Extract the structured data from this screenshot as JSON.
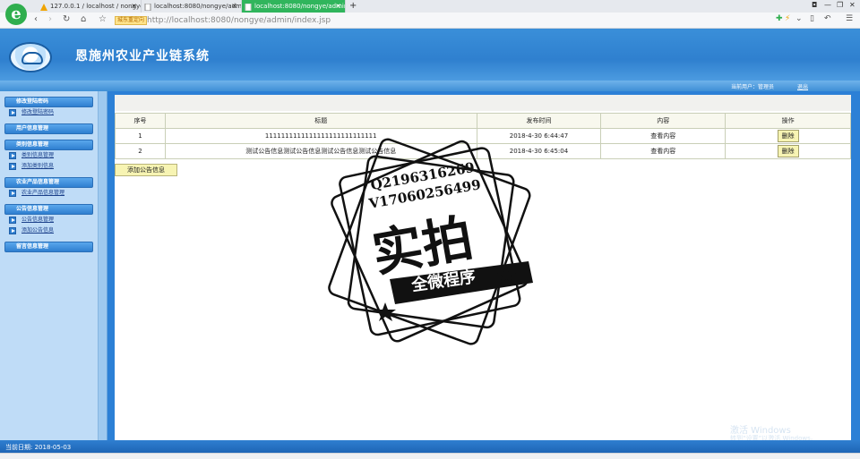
{
  "browser": {
    "tabs": [
      {
        "label": "127.0.0.1 / localhost / nongye",
        "active": false
      },
      {
        "label": "localhost:8080/nongye/admin",
        "active": false
      },
      {
        "label": "localhost:8080/nongye/admin",
        "active": true
      }
    ],
    "new_tab": "+",
    "url_tag": "城东重定向",
    "url": "http://localhost:8080/nongye/admin/index.jsp"
  },
  "header": {
    "title": "恩施州农业产业链系统",
    "user_label": "当前用户：管理员",
    "logout": "退出"
  },
  "sidebar": {
    "sections": [
      {
        "title": "修改登陆密码",
        "items": [
          "修改登陆密码"
        ]
      },
      {
        "title": "用户信息管理",
        "items": []
      },
      {
        "title": "类别信息管理",
        "items": [
          "类别信息管理",
          "添加类别信息"
        ]
      },
      {
        "title": "农业产品信息管理",
        "items": [
          "农业产品信息管理"
        ]
      },
      {
        "title": "公告信息管理",
        "items": [
          "公告信息管理",
          "添加公告信息"
        ]
      },
      {
        "title": "留言信息管理",
        "items": []
      }
    ]
  },
  "table": {
    "headers": [
      "序号",
      "标题",
      "发布时间",
      "内容",
      "操作"
    ],
    "rows": [
      {
        "no": "1",
        "title": "1111111111111111111111111111",
        "time": "2018-4-30 6:44:47",
        "content": "查看内容",
        "action": "删除"
      },
      {
        "no": "2",
        "title": "测试公告信息测试公告信息测试公告信息测试公告信息",
        "time": "2018-4-30 6:45:04",
        "content": "查看内容",
        "action": "删除"
      }
    ],
    "add_button": "添加公告信息"
  },
  "watermark": {
    "line1": "Q2196316269",
    "line2": "V17060256499",
    "main": "实拍",
    "banner": "全微程序"
  },
  "windows_activation": {
    "title": "激活 Windows",
    "subtitle": "转到“设置”以激活 Windows。"
  },
  "footer": {
    "date": "当前日期:  2018-05-03"
  },
  "colors": {
    "header_blue": "#2f80cf",
    "sidebar_bg": "#bfdcf7",
    "button_yellow": "#f7f4b3",
    "active_tab": "#30b55c"
  }
}
